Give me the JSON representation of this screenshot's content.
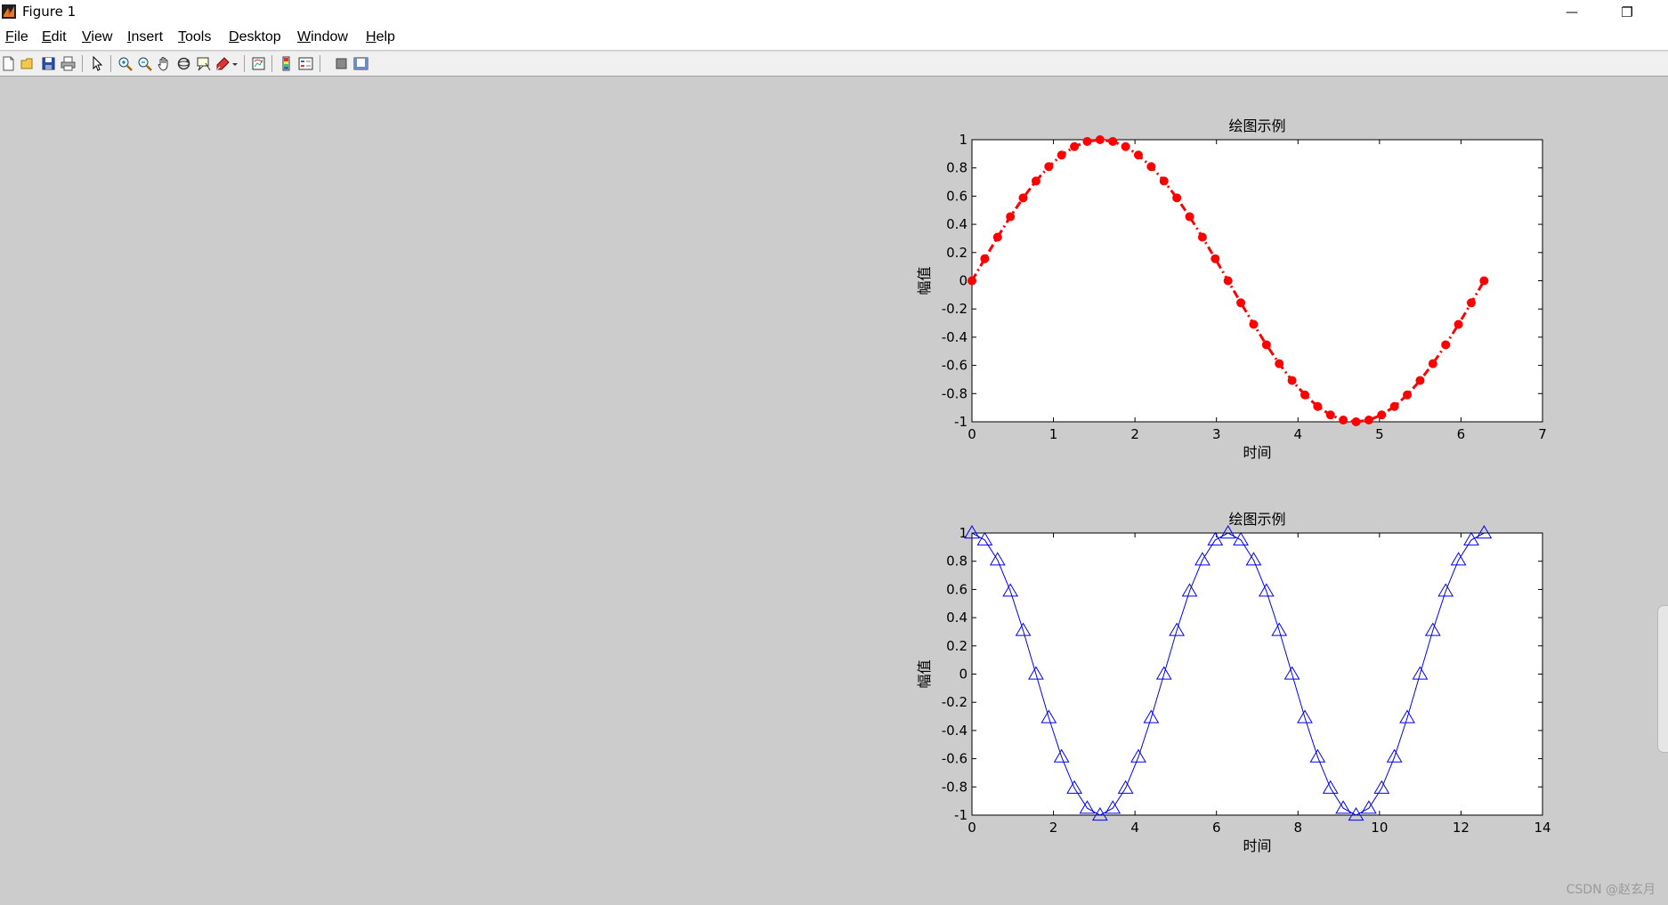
{
  "window": {
    "title": "Figure 1",
    "minimize_glyph": "—",
    "restore_glyph": "❐"
  },
  "menu": [
    {
      "key": "F",
      "rest": "ile"
    },
    {
      "key": "E",
      "rest": "dit"
    },
    {
      "key": "V",
      "rest": "iew"
    },
    {
      "key": "I",
      "rest": "nsert"
    },
    {
      "key": "T",
      "rest": "ools"
    },
    {
      "key": "D",
      "rest": "esktop"
    },
    {
      "key": "W",
      "rest": "indow"
    },
    {
      "key": "H",
      "rest": "elp"
    }
  ],
  "toolbar": {
    "icons": [
      "new-figure-icon",
      "open-file-icon",
      "save-icon",
      "print-icon",
      "edit-plot-icon",
      "zoom-in-icon",
      "zoom-out-icon",
      "pan-icon",
      "rotate-3d-icon",
      "data-cursor-icon",
      "brush-icon",
      "brush-dropdown-icon",
      "link-plot-icon",
      "insert-colorbar-icon",
      "insert-legend-icon",
      "hide-plot-tools-icon",
      "show-plot-tools-icon"
    ]
  },
  "colors": {
    "series1": "#ff0000",
    "series2": "#0000ff",
    "figure_bg": "#cccccc"
  },
  "watermark": "CSDN @赵玄月",
  "chart_data": [
    {
      "type": "line",
      "title": "绘图示例",
      "xlabel": "时间",
      "ylabel": "幅值",
      "xlim": [
        0,
        7
      ],
      "ylim": [
        -1,
        1
      ],
      "xticks": [
        0,
        1,
        2,
        3,
        4,
        5,
        6,
        7
      ],
      "yticks": [
        -1,
        -0.8,
        -0.6,
        -0.4,
        -0.2,
        0,
        0.2,
        0.4,
        0.6,
        0.8,
        1
      ],
      "ytick_labels": [
        "-1",
        "-0.8",
        "-0.6",
        "-0.4",
        "-0.2",
        "0",
        "0.2",
        "0.4",
        "0.6",
        "0.8",
        "1"
      ],
      "grid": false,
      "line_style": "dash-dot",
      "marker": "filled-circle",
      "color": "#ff0000",
      "series": [
        {
          "x": [
            0,
            0.1571,
            0.3142,
            0.4712,
            0.6283,
            0.7854,
            0.9425,
            1.0996,
            1.2566,
            1.4137,
            1.5708,
            1.7279,
            1.885,
            2.042,
            2.1991,
            2.3562,
            2.5133,
            2.6704,
            2.8274,
            2.9845,
            3.1416,
            3.2987,
            3.4558,
            3.6128,
            3.7699,
            3.927,
            4.0841,
            4.2412,
            4.3982,
            4.5553,
            4.7124,
            4.8695,
            5.0265,
            5.1836,
            5.3407,
            5.4978,
            5.6549,
            5.8119,
            5.969,
            6.1261,
            6.2832
          ],
          "y": [
            0,
            0.1564,
            0.309,
            0.454,
            0.5878,
            0.7071,
            0.809,
            0.891,
            0.9511,
            0.9877,
            1,
            0.9877,
            0.9511,
            0.891,
            0.809,
            0.7071,
            0.5878,
            0.454,
            0.309,
            0.1564,
            0,
            -0.1564,
            -0.309,
            -0.454,
            -0.5878,
            -0.7071,
            -0.809,
            -0.891,
            -0.9511,
            -0.9877,
            -1,
            -0.9877,
            -0.9511,
            -0.891,
            -0.809,
            -0.7071,
            -0.5878,
            -0.454,
            -0.309,
            -0.1564,
            0
          ]
        }
      ]
    },
    {
      "type": "line",
      "title": "绘图示例",
      "xlabel": "时间",
      "ylabel": "幅值",
      "xlim": [
        0,
        14
      ],
      "ylim": [
        -1,
        1
      ],
      "xticks": [
        0,
        2,
        4,
        6,
        8,
        10,
        12,
        14
      ],
      "yticks": [
        -1,
        -0.8,
        -0.6,
        -0.4,
        -0.2,
        0,
        0.2,
        0.4,
        0.6,
        0.8,
        1
      ],
      "ytick_labels": [
        "-1",
        "-0.8",
        "-0.6",
        "-0.4",
        "-0.2",
        "0",
        "0.2",
        "0.4",
        "0.6",
        "0.8",
        "1"
      ],
      "grid": false,
      "line_style": "solid",
      "marker": "open-triangle",
      "color": "#0000ff",
      "series": [
        {
          "x": [
            0,
            0.3142,
            0.6283,
            0.9425,
            1.2566,
            1.5708,
            1.885,
            2.1991,
            2.5133,
            2.8274,
            3.1416,
            3.4558,
            3.7699,
            4.0841,
            4.3982,
            4.7124,
            5.0265,
            5.3407,
            5.6549,
            5.969,
            6.2832,
            6.5973,
            6.9115,
            7.2257,
            7.5398,
            7.854,
            8.1681,
            8.4823,
            8.7965,
            9.1106,
            9.4248,
            9.7389,
            10.0531,
            10.3673,
            10.6814,
            10.9956,
            11.3097,
            11.6239,
            11.9381,
            12.2522,
            12.5664
          ],
          "y": [
            1,
            0.9511,
            0.809,
            0.5878,
            0.309,
            0,
            -0.309,
            -0.5878,
            -0.809,
            -0.9511,
            -1,
            -0.9511,
            -0.809,
            -0.5878,
            -0.309,
            0,
            0.309,
            0.5878,
            0.809,
            0.9511,
            1,
            0.9511,
            0.809,
            0.5878,
            0.309,
            0,
            -0.309,
            -0.5878,
            -0.809,
            -0.9511,
            -1,
            -0.9511,
            -0.809,
            -0.5878,
            -0.309,
            0,
            0.309,
            0.5878,
            0.809,
            0.9511,
            1
          ]
        }
      ]
    }
  ]
}
